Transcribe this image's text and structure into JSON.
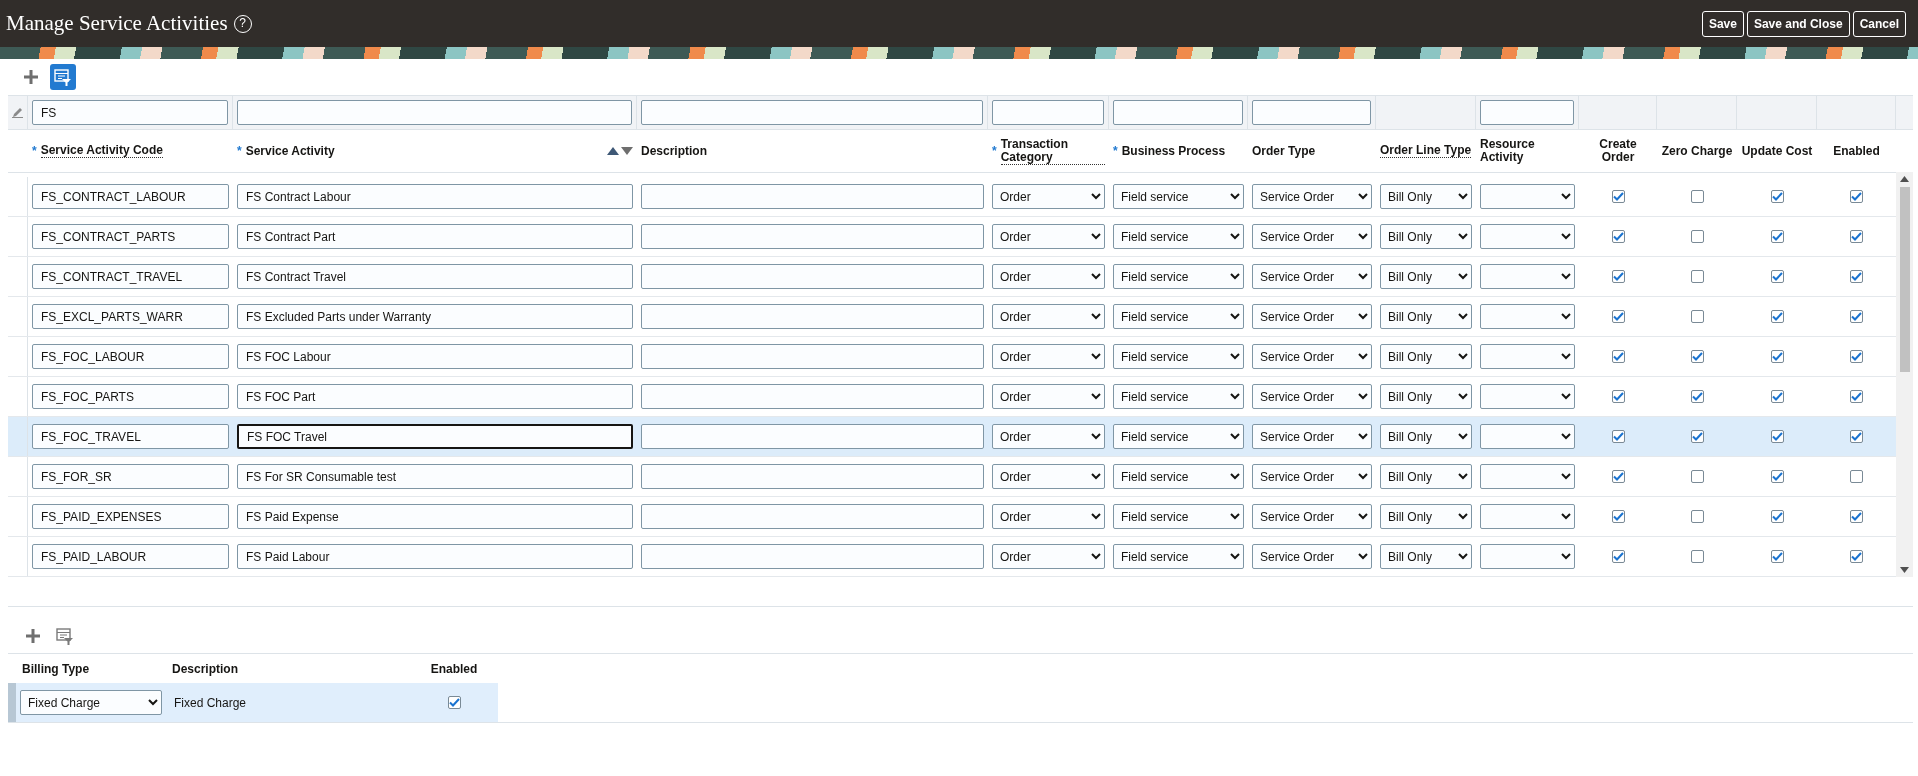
{
  "page": {
    "title": "Manage Service Activities",
    "help_glyph": "?"
  },
  "header_buttons": [
    {
      "label": "Save"
    },
    {
      "label": "Save and Close"
    },
    {
      "label": "Cancel"
    }
  ],
  "activities_toolbar": {
    "query_by_example": true
  },
  "columns": [
    {
      "label": "Service Activity Code",
      "required_mark": "*",
      "dotted": true,
      "kind": "text",
      "filter": true,
      "filter_value": "FS"
    },
    {
      "label": "Service Activity",
      "required_mark": "*",
      "dotted": false,
      "kind": "text",
      "filter": true,
      "sort_arrows": true
    },
    {
      "label": "Description",
      "dotted": false,
      "kind": "text",
      "filter": true
    },
    {
      "label": "Transaction Category",
      "required_mark": "*",
      "dotted": true,
      "kind": "select",
      "filter": true
    },
    {
      "label": "Business Process",
      "required_mark": "*",
      "dotted": false,
      "kind": "select",
      "filter": true
    },
    {
      "label": "Order Type",
      "dotted": false,
      "kind": "select",
      "filter": true
    },
    {
      "label": "Order Line Type",
      "dotted": true,
      "kind": "select",
      "filter": false
    },
    {
      "label": "Resource Activity",
      "dotted": false,
      "kind": "select",
      "filter": true
    },
    {
      "label": "Create Order",
      "dotted": false,
      "kind": "check",
      "filter": false
    },
    {
      "label": "Zero Charge",
      "dotted": false,
      "kind": "check",
      "filter": false
    },
    {
      "label": "Update Cost",
      "dotted": false,
      "kind": "check",
      "filter": false
    },
    {
      "label": "Enabled",
      "dotted": false,
      "kind": "check",
      "filter": false
    }
  ],
  "rows": [
    {
      "selected": false,
      "cells": [
        {
          "value": "FS_CONTRACT_LABOUR"
        },
        {
          "value": "FS Contract Labour"
        },
        {},
        {
          "value": "Order"
        },
        {
          "value": "Field service"
        },
        {
          "value": "Service Order"
        },
        {
          "value": "Bill Only"
        },
        {},
        {
          "checked": true
        },
        {
          "checked": false
        },
        {
          "checked": true
        },
        {
          "checked": true
        }
      ]
    },
    {
      "selected": false,
      "cells": [
        {
          "value": "FS_CONTRACT_PARTS"
        },
        {
          "value": "FS Contract Part"
        },
        {},
        {
          "value": "Order"
        },
        {
          "value": "Field service"
        },
        {
          "value": "Service Order"
        },
        {
          "value": "Bill Only"
        },
        {},
        {
          "checked": true
        },
        {
          "checked": false
        },
        {
          "checked": true
        },
        {
          "checked": true
        }
      ]
    },
    {
      "selected": false,
      "cells": [
        {
          "value": "FS_CONTRACT_TRAVEL"
        },
        {
          "value": "FS Contract Travel"
        },
        {},
        {
          "value": "Order"
        },
        {
          "value": "Field service"
        },
        {
          "value": "Service Order"
        },
        {
          "value": "Bill Only"
        },
        {},
        {
          "checked": true
        },
        {
          "checked": false
        },
        {
          "checked": true
        },
        {
          "checked": true
        }
      ]
    },
    {
      "selected": false,
      "cells": [
        {
          "value": "FS_EXCL_PARTS_WARR"
        },
        {
          "value": "FS Excluded Parts under Warranty"
        },
        {},
        {
          "value": "Order"
        },
        {
          "value": "Field service"
        },
        {
          "value": "Service Order"
        },
        {
          "value": "Bill Only"
        },
        {},
        {
          "checked": true
        },
        {
          "checked": false
        },
        {
          "checked": true
        },
        {
          "checked": true
        }
      ]
    },
    {
      "selected": false,
      "cells": [
        {
          "value": "FS_FOC_LABOUR"
        },
        {
          "value": "FS FOC Labour"
        },
        {},
        {
          "value": "Order"
        },
        {
          "value": "Field service"
        },
        {
          "value": "Service Order"
        },
        {
          "value": "Bill Only"
        },
        {},
        {
          "checked": true
        },
        {
          "checked": true
        },
        {
          "checked": true
        },
        {
          "checked": true
        }
      ]
    },
    {
      "selected": false,
      "cells": [
        {
          "value": "FS_FOC_PARTS"
        },
        {
          "value": "FS FOC Part"
        },
        {},
        {
          "value": "Order"
        },
        {
          "value": "Field service"
        },
        {
          "value": "Service Order"
        },
        {
          "value": "Bill Only"
        },
        {},
        {
          "checked": true
        },
        {
          "checked": true
        },
        {
          "checked": true
        },
        {
          "checked": true
        }
      ]
    },
    {
      "selected": true,
      "cells": [
        {
          "value": "FS_FOC_TRAVEL"
        },
        {
          "value": "FS FOC Travel",
          "focused": true
        },
        {},
        {
          "value": "Order"
        },
        {
          "value": "Field service"
        },
        {
          "value": "Service Order"
        },
        {
          "value": "Bill Only"
        },
        {},
        {
          "checked": true
        },
        {
          "checked": true
        },
        {
          "checked": true
        },
        {
          "checked": true
        }
      ]
    },
    {
      "selected": false,
      "cells": [
        {
          "value": "FS_FOR_SR"
        },
        {
          "value": "FS For SR Consumable test"
        },
        {},
        {
          "value": "Order"
        },
        {
          "value": "Field service"
        },
        {
          "value": "Service Order"
        },
        {
          "value": "Bill Only"
        },
        {},
        {
          "checked": true
        },
        {
          "checked": false
        },
        {
          "checked": true
        },
        {
          "checked": false
        }
      ]
    },
    {
      "selected": false,
      "cells": [
        {
          "value": "FS_PAID_EXPENSES"
        },
        {
          "value": "FS Paid Expense"
        },
        {},
        {
          "value": "Order"
        },
        {
          "value": "Field service"
        },
        {
          "value": "Service Order"
        },
        {
          "value": "Bill Only"
        },
        {},
        {
          "checked": true
        },
        {
          "checked": false
        },
        {
          "checked": true
        },
        {
          "checked": true
        }
      ]
    },
    {
      "selected": false,
      "cells": [
        {
          "value": "FS_PAID_LABOUR"
        },
        {
          "value": "FS Paid Labour"
        },
        {},
        {
          "value": "Order"
        },
        {
          "value": "Field service"
        },
        {
          "value": "Service Order"
        },
        {
          "value": "Bill Only"
        },
        {},
        {
          "checked": true
        },
        {
          "checked": false
        },
        {
          "checked": true
        },
        {
          "checked": true
        }
      ]
    }
  ],
  "billing_toolbar": {
    "query_by_example": false
  },
  "billing_columns": [
    {
      "label": "Billing Type",
      "kind": "select"
    },
    {
      "label": "Description",
      "kind": "text"
    },
    {
      "label": "Enabled",
      "kind": "check"
    }
  ],
  "billing_rows": [
    {
      "selected": true,
      "cells": [
        {
          "value": "Fixed Charge"
        },
        {
          "value": "Fixed Charge"
        },
        {
          "checked": true
        }
      ]
    }
  ]
}
